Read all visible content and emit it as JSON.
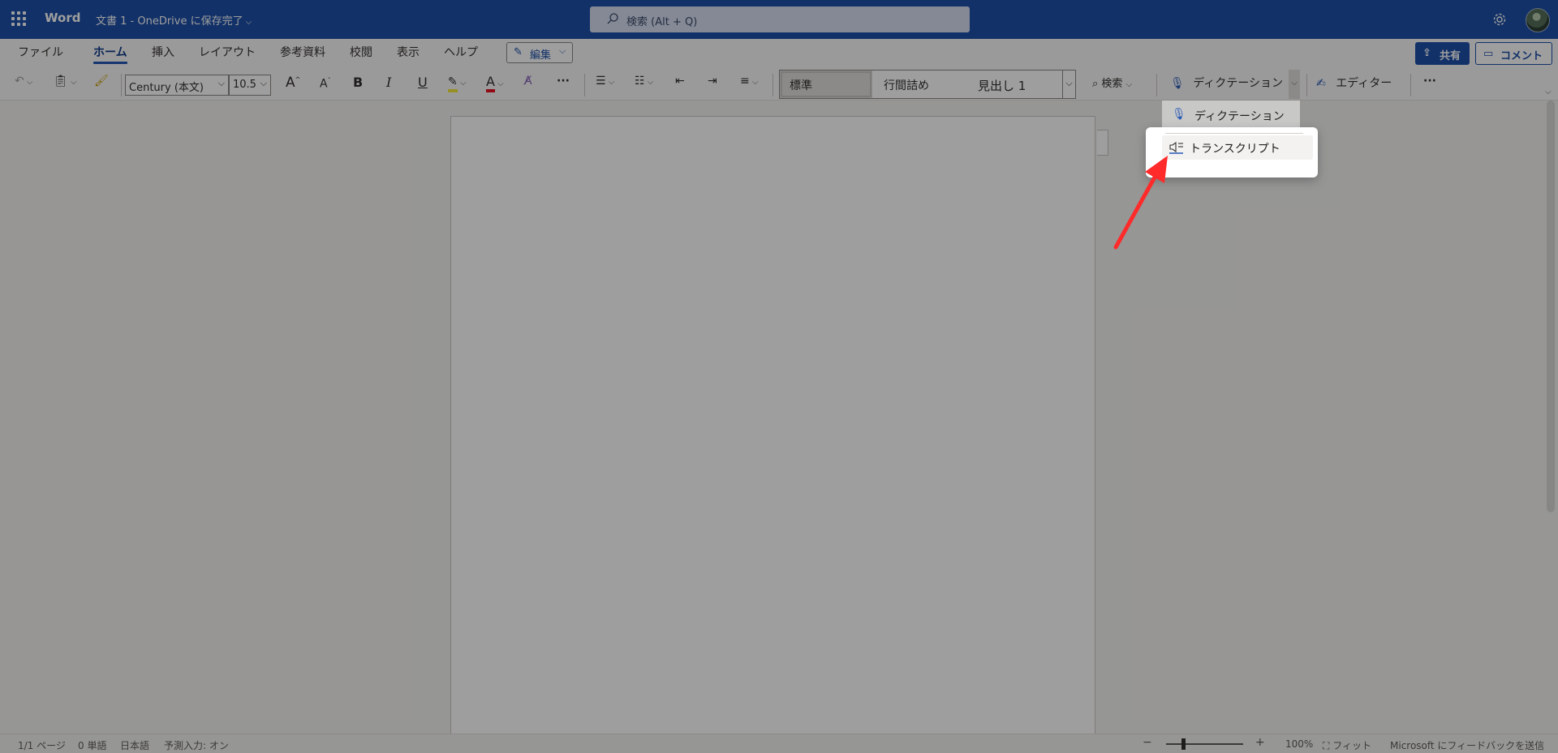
{
  "titlebar": {
    "app_name": "Word",
    "doc_title": "文書 1 - OneDrive に保存完了",
    "search_placeholder": "検索 (Alt + Q)"
  },
  "menu": {
    "tabs": [
      "ファイル",
      "ホーム",
      "挿入",
      "レイアウト",
      "参考資料",
      "校閲",
      "表示",
      "ヘルプ"
    ],
    "active_tab": "ホーム",
    "edit_label": "編集",
    "share_label": "共有",
    "comment_label": "コメント"
  },
  "ribbon": {
    "font_name": "Century (本文)",
    "font_size": "10.5",
    "bold": "B",
    "italic": "I",
    "underline": "U",
    "font_color_glyph": "A",
    "grow_font": "A",
    "shrink_font": "A",
    "styles": [
      "標準",
      "行間詰め",
      "見出し 1"
    ],
    "find_label": "検索",
    "dictate_label": "ディクテーション",
    "editor_label": "エディター",
    "more_glyph": "···"
  },
  "dictation_menu": {
    "items": [
      {
        "label": "ディクテーション",
        "icon": "microphone-icon"
      },
      {
        "label": "トランスクリプト",
        "icon": "transcribe-icon"
      }
    ]
  },
  "statusbar": {
    "page": "1/1 ページ",
    "words": "0 単語",
    "language": "日本語",
    "predictive": "予測入力: オン",
    "zoom_minus": "−",
    "zoom_plus": "+",
    "zoom": "100%",
    "fit": "フィット",
    "feedback": "Microsoft にフィードバックを送信"
  },
  "colors": {
    "titlebar": "#1e4fa8",
    "accent": "#2557b5",
    "highlight_bar": "#f3e83a",
    "font_color_bar": "#e81123",
    "arrow": "#ff2a2a"
  }
}
